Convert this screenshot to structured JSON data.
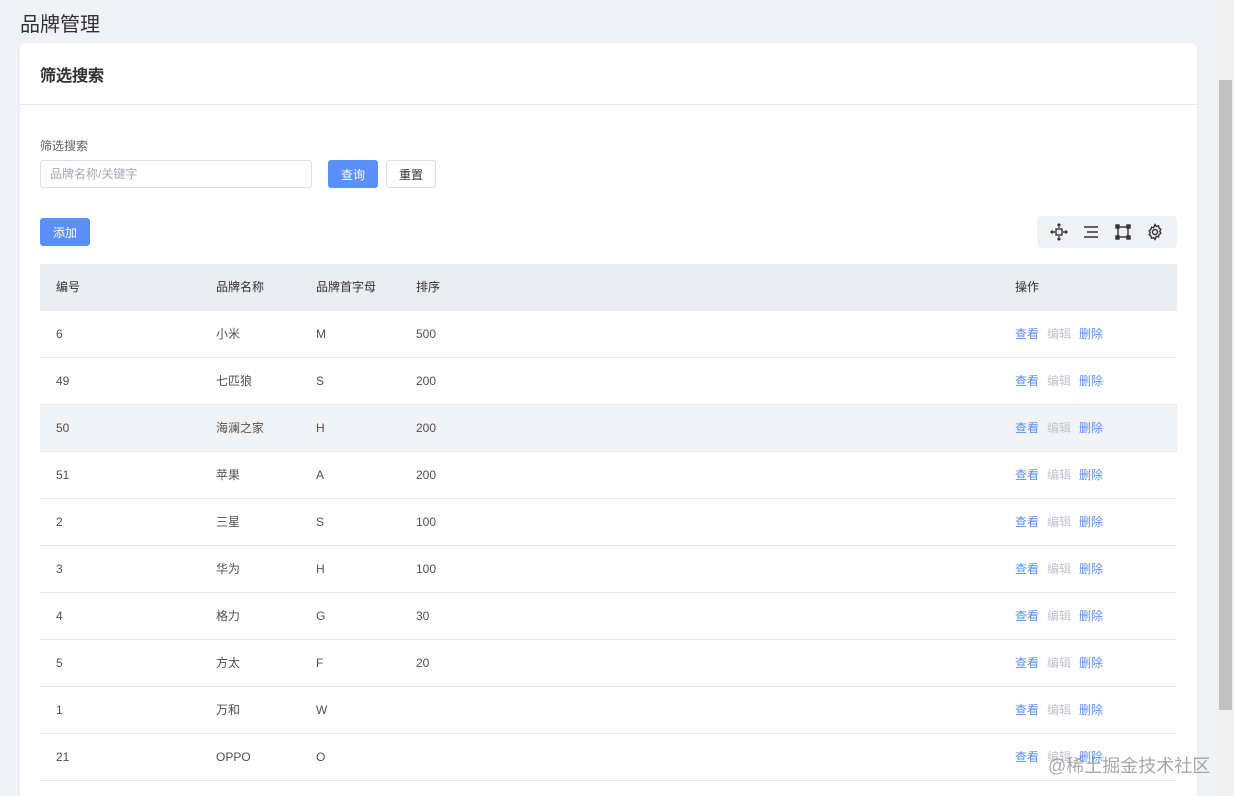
{
  "page": {
    "title": "品牌管理"
  },
  "card": {
    "header": "筛选搜索"
  },
  "filter": {
    "label": "筛选搜索",
    "search_placeholder": "品牌名称/关键字",
    "query_label": "查询",
    "reset_label": "重置"
  },
  "actions": {
    "add_label": "添加"
  },
  "toolbar": {
    "icons": [
      "drag-move-icon",
      "density-icon",
      "fullscreen-icon",
      "settings-gear-icon"
    ]
  },
  "table": {
    "headers": [
      "编号",
      "品牌名称",
      "品牌首字母",
      "排序",
      "操作"
    ],
    "op_labels": {
      "view": "查看",
      "edit": "编辑",
      "delete": "删除"
    },
    "rows": [
      {
        "id": "6",
        "name": "小米",
        "letter": "M",
        "sort": "500"
      },
      {
        "id": "49",
        "name": "七匹狼",
        "letter": "S",
        "sort": "200"
      },
      {
        "id": "50",
        "name": "海澜之家",
        "letter": "H",
        "sort": "200"
      },
      {
        "id": "51",
        "name": "苹果",
        "letter": "A",
        "sort": "200"
      },
      {
        "id": "2",
        "name": "三星",
        "letter": "S",
        "sort": "100"
      },
      {
        "id": "3",
        "name": "华为",
        "letter": "H",
        "sort": "100"
      },
      {
        "id": "4",
        "name": "格力",
        "letter": "G",
        "sort": "30"
      },
      {
        "id": "5",
        "name": "方太",
        "letter": "F",
        "sort": "20"
      },
      {
        "id": "1",
        "name": "万和",
        "letter": "W",
        "sort": ""
      },
      {
        "id": "21",
        "name": "OPPO",
        "letter": "O",
        "sort": ""
      }
    ]
  },
  "watermark": "@稀土掘金技术社区",
  "colors": {
    "primary": "#5b8ff9",
    "disabled": "#c0c4cc",
    "header_bg": "#ebedf0",
    "page_bg": "#f0f2f5"
  }
}
